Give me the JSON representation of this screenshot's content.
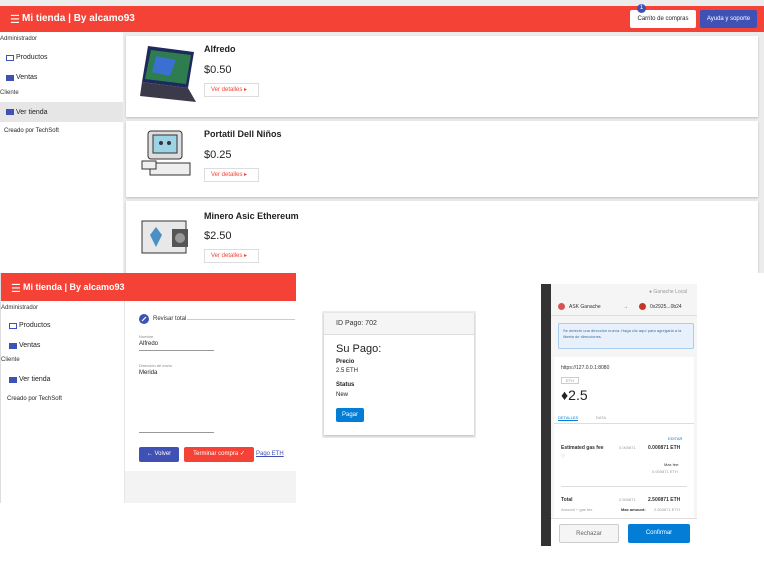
{
  "top": {
    "app_title": "Mi tienda | By alcamo93",
    "cart_label": "Carrito de compras",
    "cart_count": "1",
    "help_label": "Ayuda y soporte",
    "sidebar": {
      "admin_heading": "Administrador",
      "items": [
        {
          "label": "Productos",
          "icon": "list-icon"
        },
        {
          "label": "Ventas",
          "icon": "truck-icon"
        }
      ],
      "client_heading": "Cliente",
      "client_item": "Ver tienda",
      "footer": "Creado por TechSoft"
    },
    "products": [
      {
        "name": "Alfredo",
        "price": "$0.50",
        "details": "Ver detalles"
      },
      {
        "name": "Portatil Dell Niños",
        "price": "$0.25",
        "details": "Ver detalles"
      },
      {
        "name": "Minero Asic Ethereum",
        "price": "$2.50",
        "details": "Ver detalles"
      }
    ]
  },
  "checkout": {
    "app_title": "Mi tienda | By alcamo93",
    "sidebar": {
      "admin_heading": "Administrador",
      "items": [
        {
          "label": "Productos",
          "icon": "list-icon"
        },
        {
          "label": "Ventas",
          "icon": "truck-icon"
        }
      ],
      "client_heading": "Cliente",
      "client_item": "Ver tienda",
      "footer": "Creado por TechSoft"
    },
    "step_label": "Revisar total",
    "name_label": "Nombre",
    "name_value": "Alfredo",
    "address_label": "Dirección de envío",
    "address_value": "Merida",
    "back_label": "Volver",
    "finish_label": "Terminar compra",
    "pay_eth_label": "Pago ETH"
  },
  "payment": {
    "order_label": "ID Pago: 702",
    "title": "Su Pago:",
    "price_label": "Precio",
    "price_value": "2.5 ETH",
    "status_label": "Status",
    "status_value": "New",
    "pay_button": "Pagar"
  },
  "wallet": {
    "network": "Ganache Local",
    "from_account": "ASK Ganache",
    "to_account": "0x2925...0b24",
    "notice": "Se detectó una dirección nueva. Haga clic aquí para agregarla a la libreta de direcciones.",
    "origin": "https://127.0.0.1:8080",
    "method_tag": "ETH",
    "amount": "2.5",
    "tabs": [
      "DETALLES",
      "DATA"
    ],
    "edit_label": "EDITAR",
    "gas_label": "Estimated gas fee",
    "gas_grey": "0.000871",
    "gas_value": "0.000871 ETH",
    "max_fee_label": "Max fee:",
    "max_fee_value": "0.000871 ETH",
    "total_label": "Total",
    "total_grey": "2.500871",
    "total_value": "2.500871 ETH",
    "amount_gas_label": "Amount + gas fee",
    "max_amount_label": "Max amount:",
    "max_amount_value": "2.500871 ETH",
    "reject_label": "Rechazar",
    "confirm_label": "Confirmar"
  },
  "colors": {
    "primary_red": "#f44336",
    "indigo": "#3f51b5",
    "metamask_blue": "#037dd6"
  }
}
